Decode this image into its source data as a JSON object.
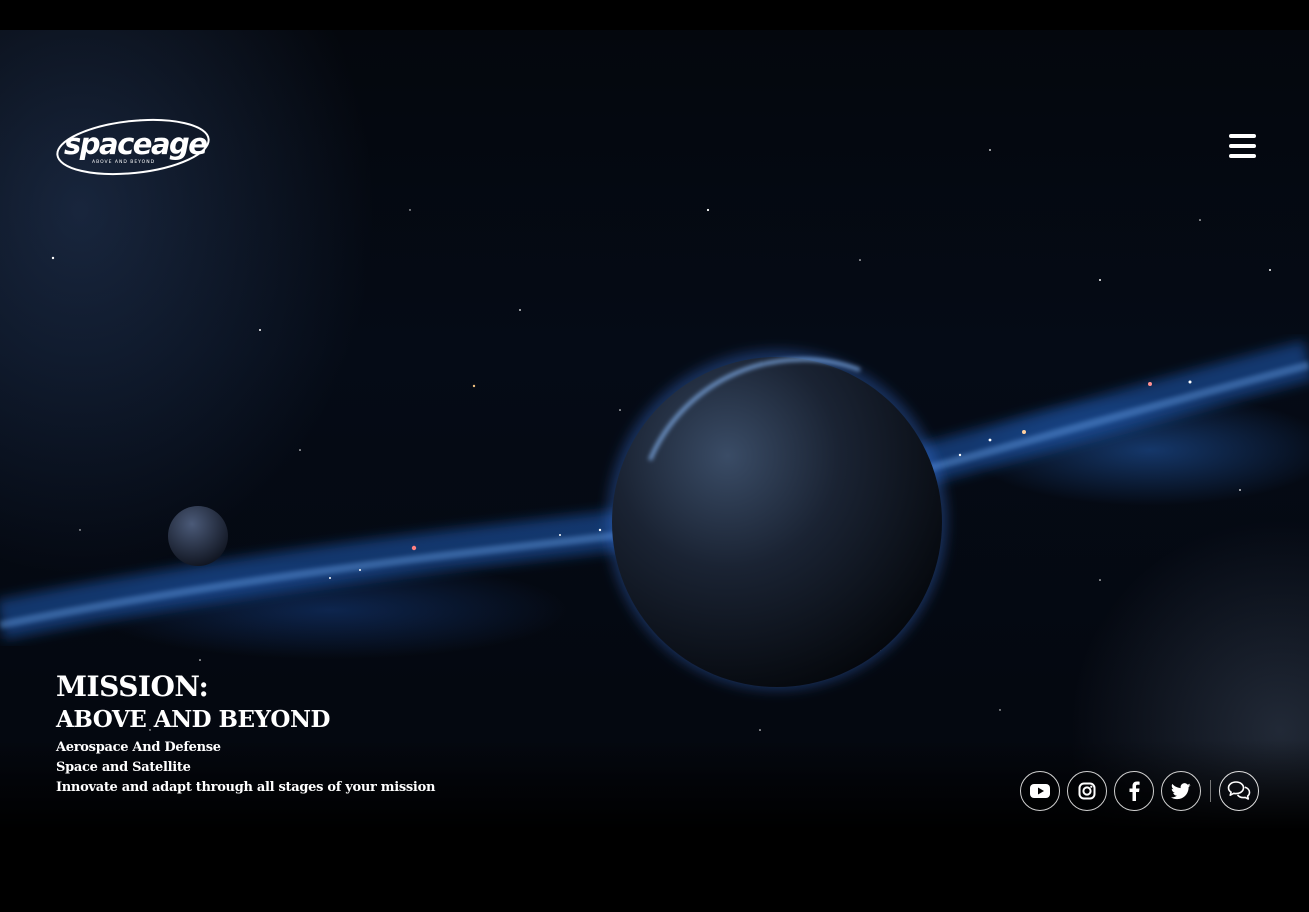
{
  "brand": {
    "logo_text": "spaceage",
    "tagline": "ABOVE AND BEYOND"
  },
  "nav": {
    "menu_icon": "hamburger-menu-icon"
  },
  "hero": {
    "title": "MISSION:",
    "subtitle": "ABOVE AND BEYOND",
    "lines": [
      "Aerospace And Defense",
      "Space and Satellite",
      "Innovate and adapt through all stages of your mission"
    ]
  },
  "social": {
    "icons": [
      "youtube-icon",
      "instagram-icon",
      "facebook-icon",
      "twitter-icon"
    ],
    "chat_icon": "chat-bubbles-icon"
  },
  "colors": {
    "background": "#000000",
    "text": "#ffffff",
    "accent_glow": "#2f6fd6"
  }
}
